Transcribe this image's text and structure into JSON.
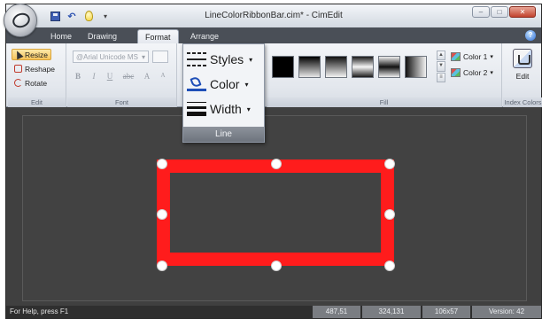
{
  "window": {
    "title": "LineColorRibbonBar.cim* - CimEdit",
    "controls": [
      "minimize",
      "maximize",
      "close"
    ]
  },
  "quick_access": {
    "icons": [
      "save-icon",
      "undo-icon",
      "lightbulb-icon",
      "customize-dropdown-icon"
    ]
  },
  "tabs": [
    {
      "label": "Home",
      "active": false
    },
    {
      "label": "Drawing",
      "active": false
    },
    {
      "label": "Format",
      "active": true
    },
    {
      "label": "Arrange",
      "active": false
    }
  ],
  "ribbon": {
    "edit_group": {
      "label": "Edit",
      "buttons": [
        {
          "label": "Resize",
          "selected": true
        },
        {
          "label": "Reshape",
          "selected": false
        },
        {
          "label": "Rotate",
          "selected": false
        }
      ]
    },
    "font_group": {
      "label": "Font",
      "font_name": "@Arial Unicode MS",
      "buttons": [
        "B",
        "I",
        "U",
        "abc",
        "A",
        "A"
      ]
    },
    "line_group": {
      "label": "Line",
      "styles_label": "Styles",
      "color_label": "Color",
      "width_label": "Width"
    },
    "fill_group": {
      "label": "Fill",
      "swatches": [
        "solid-black",
        "gradient-vertical",
        "gradient-top-dark",
        "gradient-center-light",
        "gradient-center-dark",
        "gradient-horizontal"
      ],
      "color1_label": "Color 1",
      "color2_label": "Color 2"
    },
    "index_colors_group": {
      "label": "Index Colors",
      "edit_label": "Edit"
    }
  },
  "canvas": {
    "shape": {
      "type": "rectangle",
      "stroke_color": "#ff1c1c",
      "selected": true,
      "handles": 8
    }
  },
  "status": {
    "help_text": "For Help, press F1",
    "cells": [
      "487,51",
      "324,131",
      "106x57",
      "Version: 42"
    ]
  },
  "colors": {
    "accent": "#ff1c1c",
    "workspace": "#404040",
    "selected_button": "#f6c45b"
  }
}
